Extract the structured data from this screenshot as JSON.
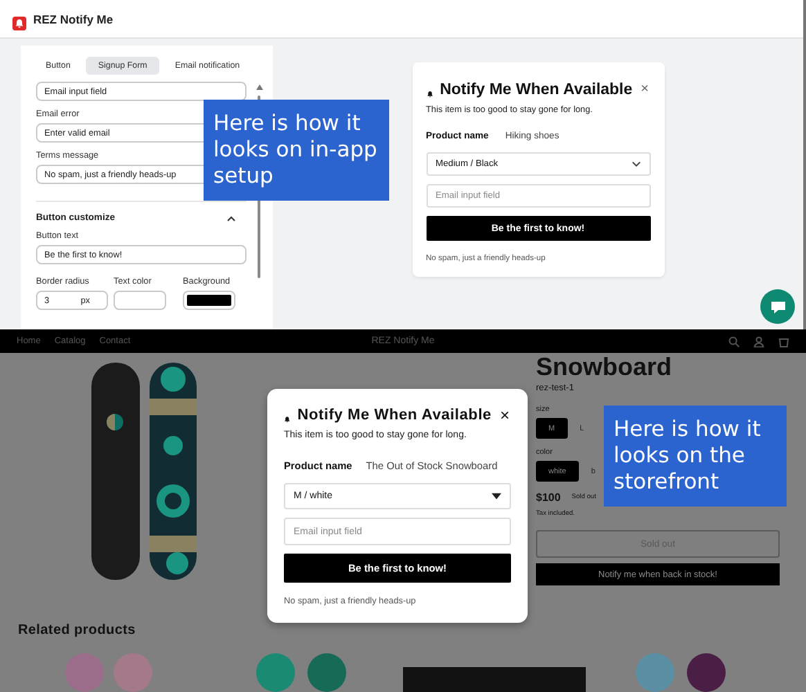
{
  "admin": {
    "app_title": "REZ Notify Me",
    "tabs": [
      {
        "label": "Button",
        "selected": false
      },
      {
        "label": "Signup Form",
        "selected": true
      },
      {
        "label": "Email notification",
        "selected": false
      }
    ],
    "fields": [
      {
        "value": "Email input field"
      },
      {
        "label": "Email error",
        "value": "Enter valid email"
      },
      {
        "label": "Terms message",
        "value": "No spam, just a friendly heads-up"
      }
    ],
    "section": {
      "title": "Button customize",
      "expanded": true
    },
    "button_text": {
      "label": "Button text",
      "value": "Be the first to know!"
    },
    "style_fields": [
      {
        "kind": "number",
        "label": "Border radius",
        "value": "3",
        "unit": "px"
      },
      {
        "kind": "color",
        "label": "Text color",
        "color": "#ffffff"
      },
      {
        "kind": "color",
        "label": "Background",
        "color": "#000000"
      }
    ],
    "preview": {
      "title": "Notify Me When Available",
      "close": "×",
      "subtitle": "This item is too good to stay gone for long.",
      "product_label": "Product name",
      "product_value": "Hiking shoes",
      "variant": "Medium / Black",
      "email_placeholder": "Email input field",
      "button": "Be the first to know!",
      "terms": "No spam, just a friendly heads-up"
    }
  },
  "storefront": {
    "nav_links": [
      "Home",
      "Catalog",
      "Contact"
    ],
    "brand": "REZ Notify Me",
    "product": {
      "title": "Snowboard",
      "sku": "rez-test-1",
      "options": [
        {
          "label": "size",
          "values": [
            {
              "label": "M",
              "selected": true
            },
            {
              "label": "L",
              "selected": false
            }
          ]
        },
        {
          "label": "color",
          "values": [
            {
              "label": "white",
              "selected": true
            },
            {
              "label": "b",
              "selected": false
            }
          ]
        }
      ],
      "price": "$100",
      "badge": "Sold out",
      "tax": "Tax included.",
      "buttons": [
        {
          "label": "Sold out",
          "disabled": true
        },
        {
          "label": "Notify me when back in stock!",
          "disabled": false
        }
      ]
    },
    "related_title": "Related products",
    "modal": {
      "title": "Notify Me When Available",
      "close": "×",
      "subtitle": "This item is too good to stay gone for long.",
      "product_label": "Product name",
      "product_value": "The Out of Stock Snowboard",
      "variant": "M / white",
      "email_placeholder": "Email input field",
      "button": "Be the first to know!",
      "terms": "No spam, just a friendly heads-up"
    }
  },
  "callouts": [
    {
      "text": "Here is how it looks on in-app setup"
    },
    {
      "text": "Here is how it looks on the storefront"
    }
  ]
}
